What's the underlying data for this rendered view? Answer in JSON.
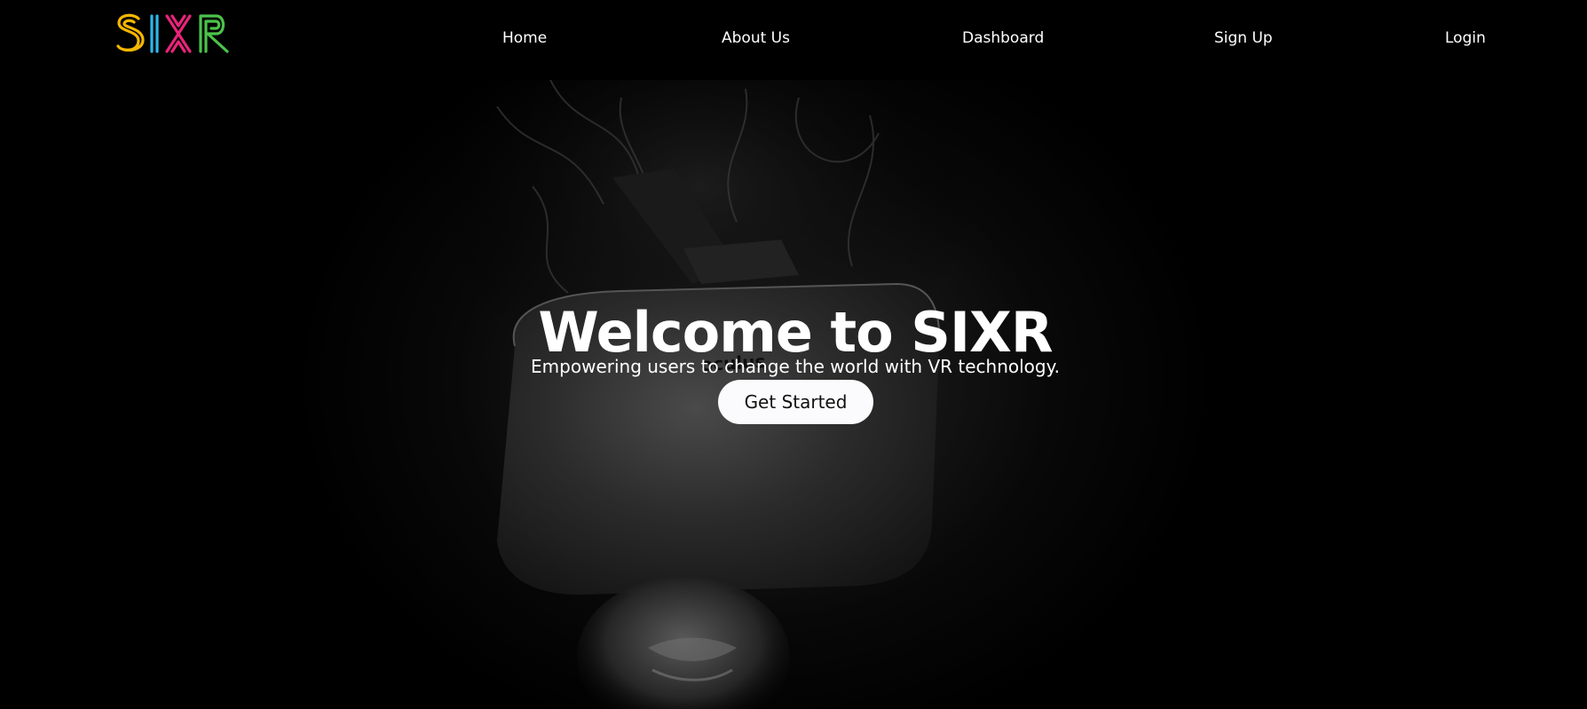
{
  "brand": {
    "logo_text": "SIXR",
    "logo_colors": [
      "#f5b700",
      "#2fb6e8",
      "#e8247a",
      "#4cc24a"
    ]
  },
  "nav": {
    "items": [
      {
        "label": "Home"
      },
      {
        "label": "About Us"
      },
      {
        "label": "Dashboard"
      },
      {
        "label": "Sign Up"
      },
      {
        "label": "Login"
      }
    ]
  },
  "hero": {
    "title": "Welcome to SIXR",
    "subtitle": "Empowering users to change the world with VR technology.",
    "cta_label": "Get Started",
    "headset_brand": "oculus",
    "background_image": "person-wearing-vr-headset-image"
  },
  "colors": {
    "background": "#000000",
    "text": "#ffffff",
    "button_bg": "#fbfbfd",
    "button_text": "#111111"
  }
}
